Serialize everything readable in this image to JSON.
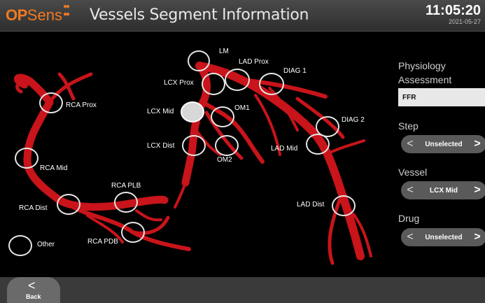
{
  "header": {
    "brand_op": "OP",
    "brand_sens": "Sens",
    "title": "Vessels Segment Information",
    "time": "11:05:20",
    "date": "2021-05-27"
  },
  "map": {
    "labels": {
      "lm": "LM",
      "lad_prox": "LAD Prox",
      "diag1": "DIAG 1",
      "lcx_prox": "LCX Prox",
      "lcx_mid": "LCX Mid",
      "om1": "OM1",
      "diag2": "DIAG 2",
      "lcx_dist": "LCX Dist",
      "om2": "OM2",
      "lad_mid": "LAD Mid",
      "lad_dist": "LAD Dist",
      "rca_prox": "RCA Prox",
      "rca_mid": "RCA Mid",
      "rca_plb": "RCA PLB",
      "rca_dist": "RCA Dist",
      "rca_pdb": "RCA PDB",
      "other": "Other"
    },
    "selected": "LCX Mid",
    "vessel_color": "#c8141a"
  },
  "side": {
    "physiology_label": "Physiology",
    "assessment_label": "Assessment",
    "assessment_value": "FFR",
    "step_label": "Step",
    "step_value": "Unselected",
    "vessel_label": "Vessel",
    "vessel_value": "LCX Mid",
    "drug_label": "Drug",
    "drug_value": "Unselected"
  },
  "footer": {
    "back_label": "Back"
  },
  "icons": {
    "back": "chevron-left-icon",
    "prev": "chevron-left-icon",
    "next": "chevron-right-icon"
  },
  "colors": {
    "brand": "#f07a21",
    "header_bg": "#3a3a3a",
    "pill_bg": "#5a5a5a"
  }
}
